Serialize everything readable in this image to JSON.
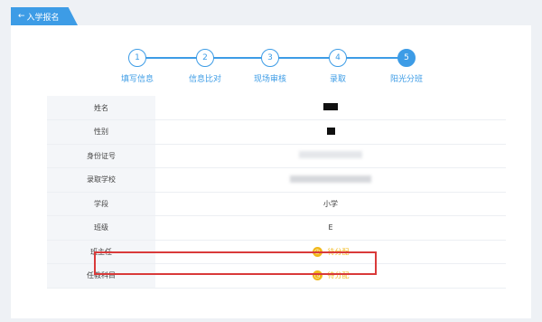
{
  "nav": {
    "back_label": "入学报名",
    "back_icon": "arrow-left-icon"
  },
  "stepper": {
    "accent": "#3d9ce6",
    "steps": [
      {
        "number": "1",
        "label": "填写信息"
      },
      {
        "number": "2",
        "label": "信息比对"
      },
      {
        "number": "3",
        "label": "现场审核"
      },
      {
        "number": "4",
        "label": "录取"
      },
      {
        "number": "5",
        "label": "阳光分班"
      }
    ],
    "active_step": "5"
  },
  "info": {
    "name_label": "姓名",
    "gender_label": "性别",
    "id_label": "身份证号",
    "school_label": "录取学校",
    "stage_label": "学段",
    "stage_value": "小学",
    "class_label": "班级",
    "class_value": "E",
    "teacher_label": "班主任",
    "teacher_value": "待分配",
    "subjects_label": "任教科目",
    "subjects_value": "待分配"
  },
  "colors": {
    "pending": "#f1b81a",
    "highlight": "#d93a3a"
  }
}
